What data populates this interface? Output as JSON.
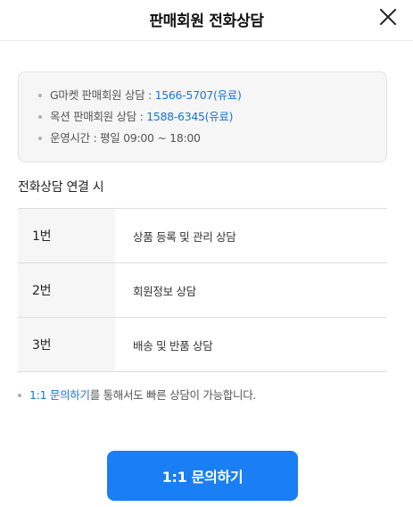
{
  "header": {
    "title": "판매회원 전화상담",
    "close_icon": "close-icon"
  },
  "info": {
    "gmarket_label": "G마켓 판매회원 상담 : ",
    "gmarket_phone": "1566-5707(유료)",
    "auction_label": "옥션 판매회원 상담 : ",
    "auction_phone": "1588-6345(유료)",
    "hours": "운영시간 : 평일 09:00 ~ 18:00"
  },
  "section": {
    "title": "전화상담 연결 시"
  },
  "options": [
    {
      "number": "1번",
      "description": "상품 등록 및 관리 상담"
    },
    {
      "number": "2번",
      "description": "회원정보 상담"
    },
    {
      "number": "3번",
      "description": "배송 및 반품 상담"
    }
  ],
  "notice": {
    "link_text": "1:1 문의하기",
    "rest_text": "를 통해서도 빠른 상담이 가능합니다."
  },
  "cta": {
    "label": "1:1 문의하기"
  },
  "colors": {
    "accent": "#1a7ef5",
    "link": "#1a73d9",
    "box_bg": "#f6f6f6"
  }
}
